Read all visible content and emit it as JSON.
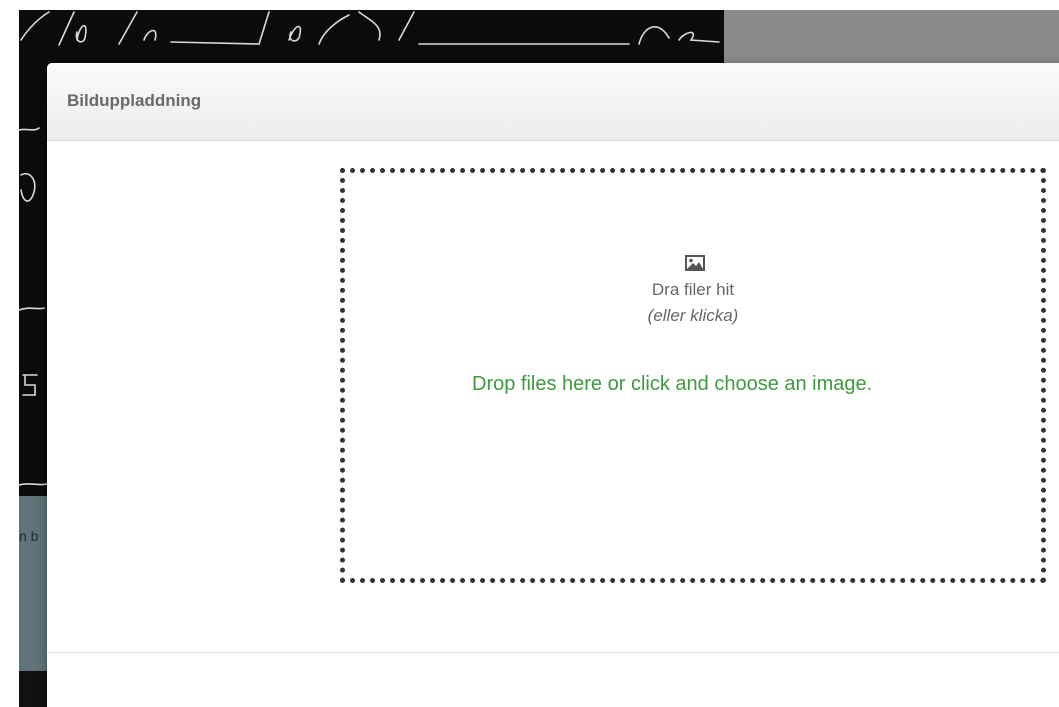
{
  "background": {
    "snippet_text": "n b"
  },
  "modal": {
    "title": "Bilduppladdning",
    "dropzone": {
      "icon": "image-icon",
      "primary_text": "Dra filer hit",
      "secondary_text": "(eller klicka)",
      "hint_text": "Drop files here or click and choose an image."
    }
  },
  "colors": {
    "hint_green": "#3f9a3f",
    "title_gray": "#6a6a6a",
    "dropzone_border": "#333333"
  }
}
